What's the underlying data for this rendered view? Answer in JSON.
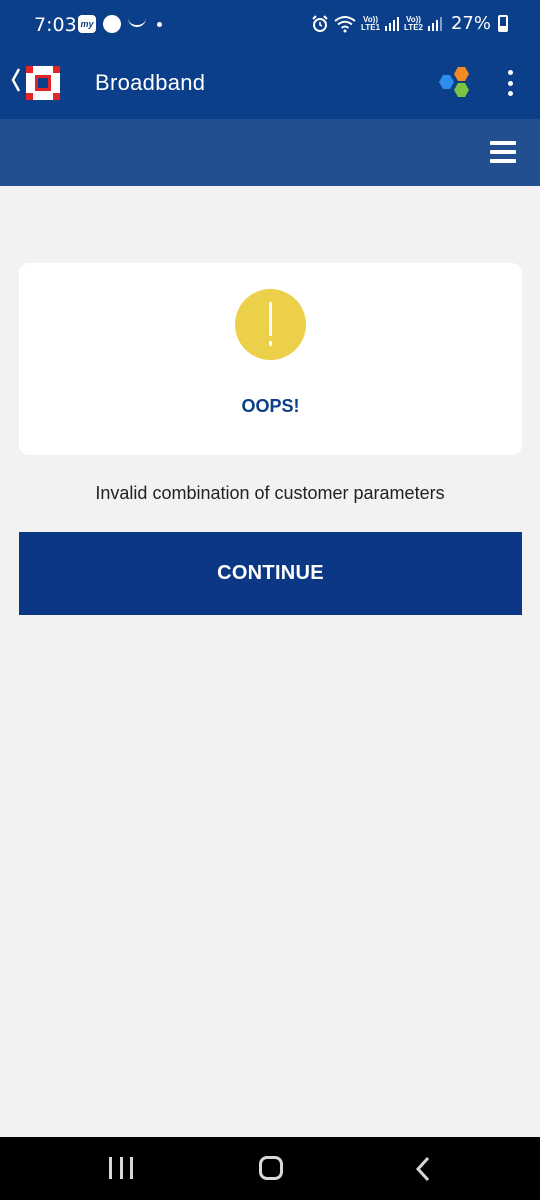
{
  "status_bar": {
    "time": "7:03",
    "mini_app_label": "my",
    "lte1_label": "Vo))\nLTE1",
    "lte2_label": "Vo))\nLTE2",
    "battery_percent": "27%"
  },
  "app_bar": {
    "title": "Broadband"
  },
  "error_card": {
    "heading": "OOPS!"
  },
  "message": "Invalid combination of customer parameters",
  "continue_button": {
    "label": "CONTINUE"
  },
  "colors": {
    "primary": "#0b3f8a",
    "secondary_bar": "#234f90",
    "warning": "#ecd049",
    "button": "#0b3784",
    "background": "#f2f2f2"
  },
  "icons": [
    "chevron-left-icon",
    "bank-logo-icon",
    "hexagon-apps-icon",
    "more-vert-icon",
    "menu-icon",
    "alert-icon",
    "nav-recents-icon",
    "nav-home-icon",
    "nav-back-icon"
  ]
}
